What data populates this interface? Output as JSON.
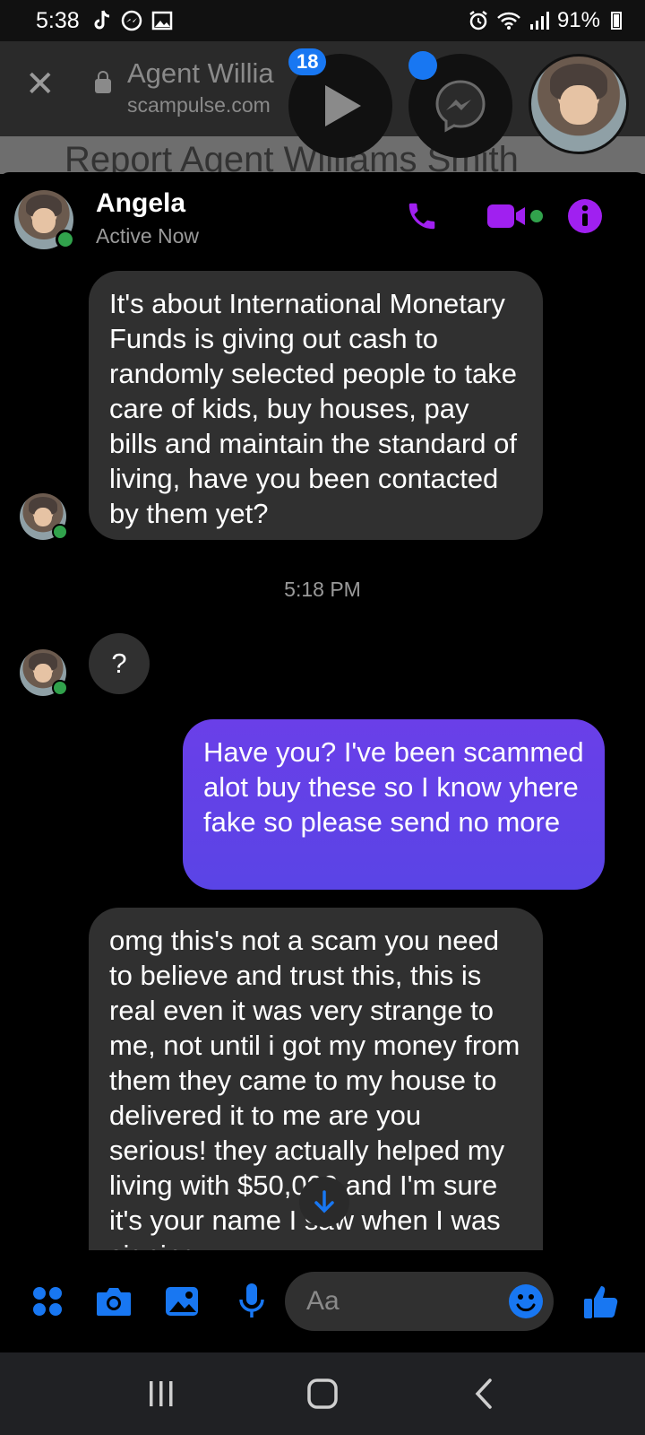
{
  "status_bar": {
    "time": "5:38",
    "battery": "91%",
    "icons_left": [
      "tiktok-icon",
      "messenger-icon",
      "gallery-icon"
    ],
    "icons_right": [
      "alarm-icon",
      "wifi-icon",
      "signal-icon",
      "battery-icon"
    ]
  },
  "browser": {
    "title": "Agent Willia",
    "url": "scampulse.com",
    "page_heading": "Report Agent Williams Smith"
  },
  "chat_heads": {
    "video_badge": "18"
  },
  "header": {
    "name": "Angela",
    "status": "Active Now"
  },
  "messages": [
    {
      "side": "in",
      "text": "It's about International Monetary Funds is giving out cash to randomly selected people to take care of kids, buy houses, pay bills and maintain the standard of living, have you been contacted by them yet?"
    },
    {
      "side": "timestamp",
      "text": "5:18 PM"
    },
    {
      "side": "in",
      "text": "?"
    },
    {
      "side": "out",
      "text": "Have you? I've been scammed alot buy these so I know yhere fake so please send no more"
    },
    {
      "side": "in",
      "text": "omg this's not a scam you need to believe and trust this, this is real even it was very strange to me, not until i got my money from them they came to my house to delivered it to me are you serious! they actually helped my living with $50,000 and I'm sure it's your name I saw when I was signing"
    }
  ],
  "composer": {
    "placeholder": "Aa"
  },
  "colors": {
    "accent_purple": "#a020f0",
    "messenger_blue": "#1877f2",
    "outgoing_bubble": "#5f43e8",
    "incoming_bubble": "#303030",
    "online_green": "#31a24c"
  }
}
